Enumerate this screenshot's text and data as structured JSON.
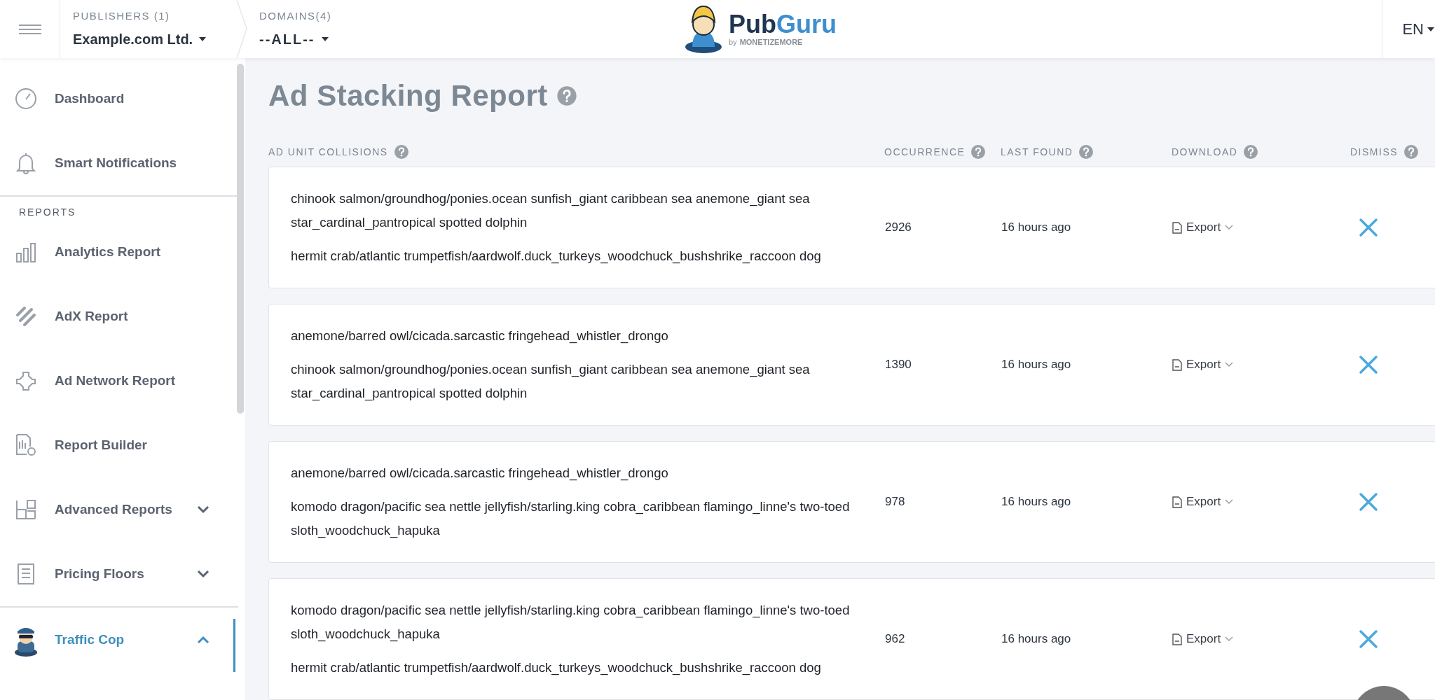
{
  "topbar": {
    "publishers": {
      "label": "PUBLISHERS (1)",
      "value": "Example.com Ltd."
    },
    "domains": {
      "label": "DOMAINS(4)",
      "value": "--ALL--"
    },
    "logo": {
      "part_1": "Pub",
      "part_2": "Guru",
      "tagline_prefix": "by",
      "tagline": "MONETIZEMORE"
    },
    "language": "EN"
  },
  "sidebar": {
    "groups": [
      {
        "items": [
          {
            "label": "Dashboard",
            "selected": false
          },
          {
            "label": "Smart Notifications",
            "selected": false
          }
        ]
      },
      {
        "heading": "REPORTS",
        "items": [
          {
            "label": "Analytics Report",
            "selected": false
          },
          {
            "label": "AdX Report",
            "selected": false
          },
          {
            "label": "Ad Network Report",
            "selected": false
          },
          {
            "label": "Report Builder",
            "selected": false
          },
          {
            "label": "Advanced Reports",
            "selected": false,
            "expanded": false
          },
          {
            "label": "Pricing Floors",
            "selected": false,
            "expanded": false
          }
        ]
      },
      {
        "items": [
          {
            "label": "Traffic Cop",
            "selected": true,
            "expanded": true
          }
        ]
      }
    ]
  },
  "page": {
    "title": "Ad Stacking Report"
  },
  "table": {
    "columns": [
      "AD UNIT COLLISIONS",
      "OCCURRENCE",
      "LAST FOUND",
      "DOWNLOAD",
      "DISMISS"
    ],
    "rows": [
      {
        "collisions": [
          "chinook salmon/groundhog/ponies.ocean sunfish_giant caribbean sea anemone_giant sea star_cardinal_pantropical spotted dolphin",
          "hermit crab/atlantic trumpetfish/aardwolf.duck_turkeys_woodchuck_bushshrike_raccoon dog"
        ],
        "occurrence": "2926",
        "last_found": "16 hours ago",
        "download": "Export"
      },
      {
        "collisions": [
          "anemone/barred owl/cicada.sarcastic fringehead_whistler_drongo",
          "chinook salmon/groundhog/ponies.ocean sunfish_giant caribbean sea anemone_giant sea star_cardinal_pantropical spotted dolphin"
        ],
        "occurrence": "1390",
        "last_found": "16 hours ago",
        "download": "Export"
      },
      {
        "collisions": [
          "anemone/barred owl/cicada.sarcastic fringehead_whistler_drongo",
          "komodo dragon/pacific sea nettle jellyfish/starling.king cobra_caribbean flamingo_linne's two-toed sloth_woodchuck_hapuka"
        ],
        "occurrence": "978",
        "last_found": "16 hours ago",
        "download": "Export"
      },
      {
        "collisions": [
          "komodo dragon/pacific sea nettle jellyfish/starling.king cobra_caribbean flamingo_linne's two-toed sloth_woodchuck_hapuka",
          "hermit crab/atlantic trumpetfish/aardwolf.duck_turkeys_woodchuck_bushshrike_raccoon dog"
        ],
        "occurrence": "962",
        "last_found": "16 hours ago",
        "download": "Export"
      }
    ]
  }
}
